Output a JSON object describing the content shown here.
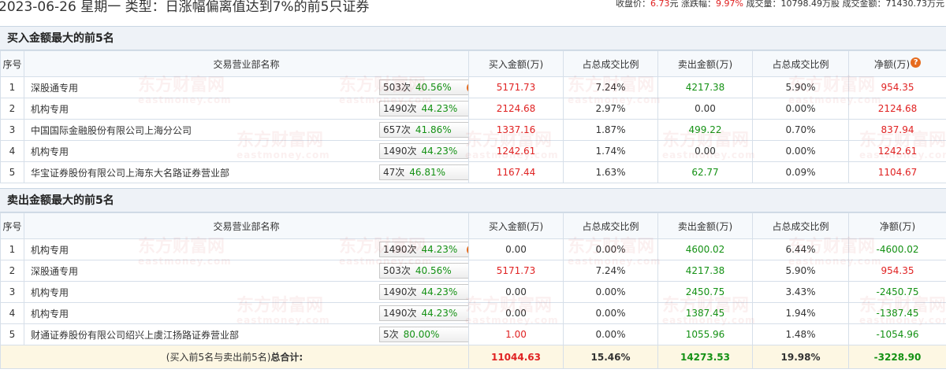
{
  "header": {
    "title": "2023-06-26 星期一 类型：日涨幅偏离值达到7%的前5只证券",
    "close_label": "收盘价：",
    "close_value": "6.73",
    "close_unit": "元",
    "change_label": "涨跌幅：",
    "change_value": "9.97%",
    "volume_label": "成交量：",
    "volume_value": "10798.49万股",
    "amount_label": "成交金额：",
    "amount_value": "71430.73万元"
  },
  "watermark": {
    "cn": "东方财富网",
    "en": "eastmoney.com"
  },
  "buy_section": {
    "title": "买入金额最大的前5名",
    "columns": [
      "序号",
      "交易营业部名称",
      "买入金额(万)",
      "占总成交比例",
      "卖出金额(万)",
      "占总成交比例",
      "净额(万)"
    ],
    "rows": [
      {
        "no": "1",
        "name": "深股通专用",
        "times": "503次",
        "pct": "40.56%",
        "buy": "5171.73",
        "buy_ratio": "7.24%",
        "sell": "4217.38",
        "sell_ratio": "5.90%",
        "net": "954.35"
      },
      {
        "no": "2",
        "name": "机构专用",
        "times": "1490次",
        "pct": "44.23%",
        "buy": "2124.68",
        "buy_ratio": "2.97%",
        "sell": "0.00",
        "sell_ratio": "0.00%",
        "net": "2124.68"
      },
      {
        "no": "3",
        "name": "中国国际金融股份有限公司上海分公司",
        "times": "657次",
        "pct": "41.86%",
        "buy": "1337.16",
        "buy_ratio": "1.87%",
        "sell": "499.22",
        "sell_ratio": "0.70%",
        "net": "837.94"
      },
      {
        "no": "4",
        "name": "机构专用",
        "times": "1490次",
        "pct": "44.23%",
        "buy": "1242.61",
        "buy_ratio": "1.74%",
        "sell": "0.00",
        "sell_ratio": "0.00%",
        "net": "1242.61"
      },
      {
        "no": "5",
        "name": "华宝证券股份有限公司上海东大名路证券营业部",
        "times": "47次",
        "pct": "46.81%",
        "buy": "1167.44",
        "buy_ratio": "1.63%",
        "sell": "62.77",
        "sell_ratio": "0.09%",
        "net": "1104.67"
      }
    ]
  },
  "sell_section": {
    "title": "卖出金额最大的前5名",
    "columns": [
      "序号",
      "交易营业部名称",
      "买入金额(万)",
      "占总成交比例",
      "卖出金额(万)",
      "占总成交比例",
      "净额(万)"
    ],
    "rows": [
      {
        "no": "1",
        "name": "机构专用",
        "times": "1490次",
        "pct": "44.23%",
        "buy": "0.00",
        "buy_ratio": "0.00%",
        "sell": "4600.02",
        "sell_ratio": "6.44%",
        "net": "-4600.02"
      },
      {
        "no": "2",
        "name": "深股通专用",
        "times": "503次",
        "pct": "40.56%",
        "buy": "5171.73",
        "buy_ratio": "7.24%",
        "sell": "4217.38",
        "sell_ratio": "5.90%",
        "net": "954.35"
      },
      {
        "no": "3",
        "name": "机构专用",
        "times": "1490次",
        "pct": "44.23%",
        "buy": "0.00",
        "buy_ratio": "0.00%",
        "sell": "2450.75",
        "sell_ratio": "3.43%",
        "net": "-2450.75"
      },
      {
        "no": "4",
        "name": "机构专用",
        "times": "1490次",
        "pct": "44.23%",
        "buy": "0.00",
        "buy_ratio": "0.00%",
        "sell": "1387.45",
        "sell_ratio": "1.94%",
        "net": "-1387.45"
      },
      {
        "no": "5",
        "name": "财通证券股份有限公司绍兴上虞江扬路证券营业部",
        "times": "5次",
        "pct": "80.00%",
        "buy": "1.00",
        "buy_ratio": "0.00%",
        "sell": "1055.96",
        "sell_ratio": "1.48%",
        "net": "-1054.96"
      }
    ]
  },
  "total": {
    "label_prefix": "(买入前5名与卖出前5名)",
    "label_bold": "总合计:",
    "buy": "11044.63",
    "buy_ratio": "15.46%",
    "sell": "14273.53",
    "sell_ratio": "19.98%",
    "net": "-3228.90"
  },
  "colors": {
    "up": "#e02222",
    "down": "#149114",
    "header_bg": "#eef2f7",
    "total_bg": "#fdf7e3",
    "icon": "#e66b1e"
  },
  "icons": {
    "help": "question-circle-icon",
    "expand": "play-arrow-icon"
  }
}
